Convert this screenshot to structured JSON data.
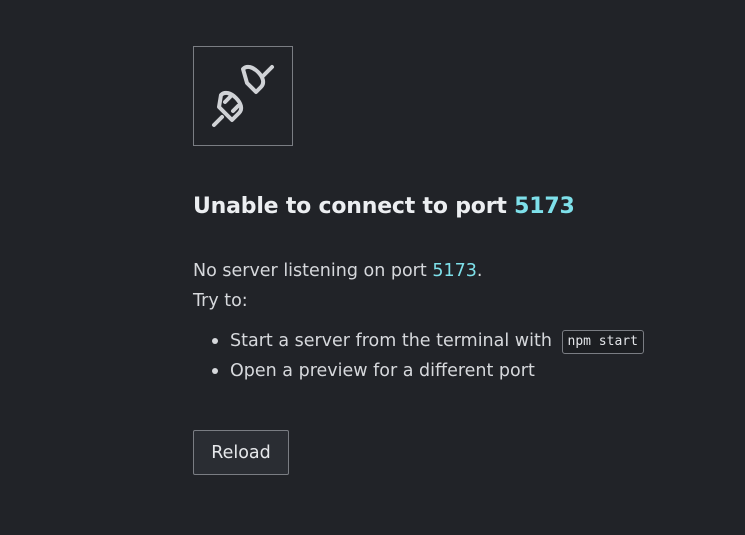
{
  "heading": {
    "prefix": "Unable to connect to port ",
    "port": "5173"
  },
  "message": {
    "line_prefix": "No server listening on port ",
    "port": "5173",
    "line_suffix": ".",
    "try_label": "Try to:"
  },
  "suggestions": {
    "start_server": "Start a server from the terminal with",
    "command": "npm start",
    "open_preview": "Open a preview for a different port"
  },
  "buttons": {
    "reload_label": "Reload"
  },
  "icon": {
    "name": "disconnected-plug-icon",
    "color": "#d0d2d6"
  },
  "colors": {
    "background": "#212328",
    "accent": "#7ee0ea",
    "border": "#7a7d83"
  }
}
